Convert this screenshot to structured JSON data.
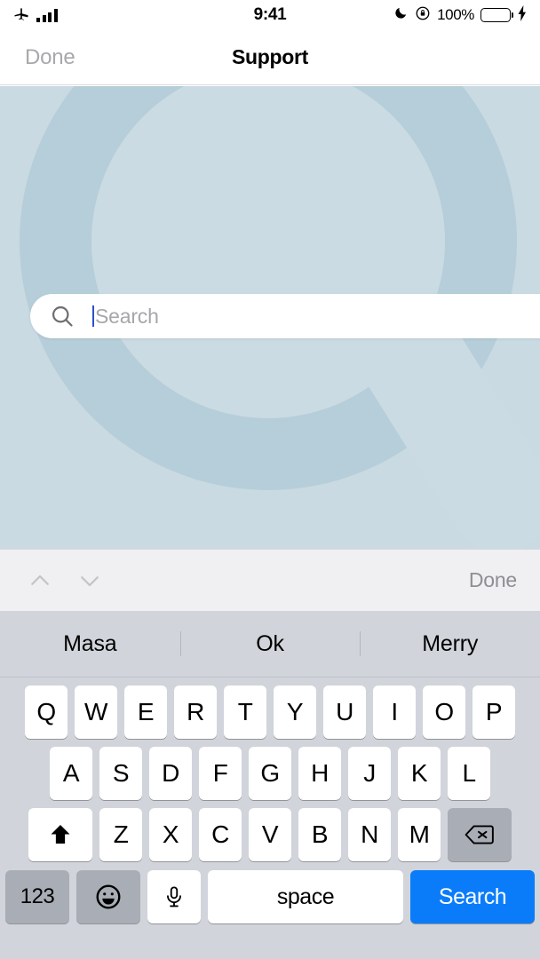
{
  "status_bar": {
    "airplane_icon": "airplane-mode-icon",
    "signal_icon": "cellular-signal-bars",
    "time": "9:41",
    "dnd_icon": "moon-do-not-disturb-icon",
    "rotation_lock_icon": "rotation-lock-icon",
    "battery_percent": "100%",
    "battery_icon": "battery-full-icon",
    "charging_icon": "lightning-bolt-icon",
    "battery_color": "#35d04a"
  },
  "nav_bar": {
    "left_button": "Done",
    "title": "Support",
    "left_button_color": "#a8a8ad"
  },
  "hero": {
    "background_color": "#c9dae2",
    "shape_color": "#b6ced9",
    "highlight_color": "#cbdbe3",
    "decoration_icon": "magnifying-glass-watermark"
  },
  "search": {
    "icon": "search-icon",
    "placeholder": "Search",
    "value": "",
    "caret_color": "#2b4fd0",
    "placeholder_color": "#a6a6ab"
  },
  "keyboard_toolbar": {
    "prev_icon": "chevron-up-icon",
    "next_icon": "chevron-down-icon",
    "done_label": "Done",
    "done_color": "#8e8e93",
    "background": "#f0f0f2"
  },
  "keyboard": {
    "background": "#d1d4da",
    "predictions": [
      "Masa",
      "Ok",
      "Merry"
    ],
    "row1": [
      "Q",
      "W",
      "E",
      "R",
      "T",
      "Y",
      "U",
      "I",
      "O",
      "P"
    ],
    "row2": [
      "A",
      "S",
      "D",
      "F",
      "G",
      "H",
      "J",
      "K",
      "L"
    ],
    "row3": [
      "Z",
      "X",
      "C",
      "V",
      "B",
      "N",
      "M"
    ],
    "shift_icon": "shift-arrow-up-icon",
    "backspace_icon": "backspace-delete-icon",
    "numbers_label": "123",
    "emoji_icon": "emoji-smiley-icon",
    "dictation_icon": "microphone-icon",
    "space_label": "space",
    "return_label": "Search",
    "return_color": "#0a7cf9"
  }
}
